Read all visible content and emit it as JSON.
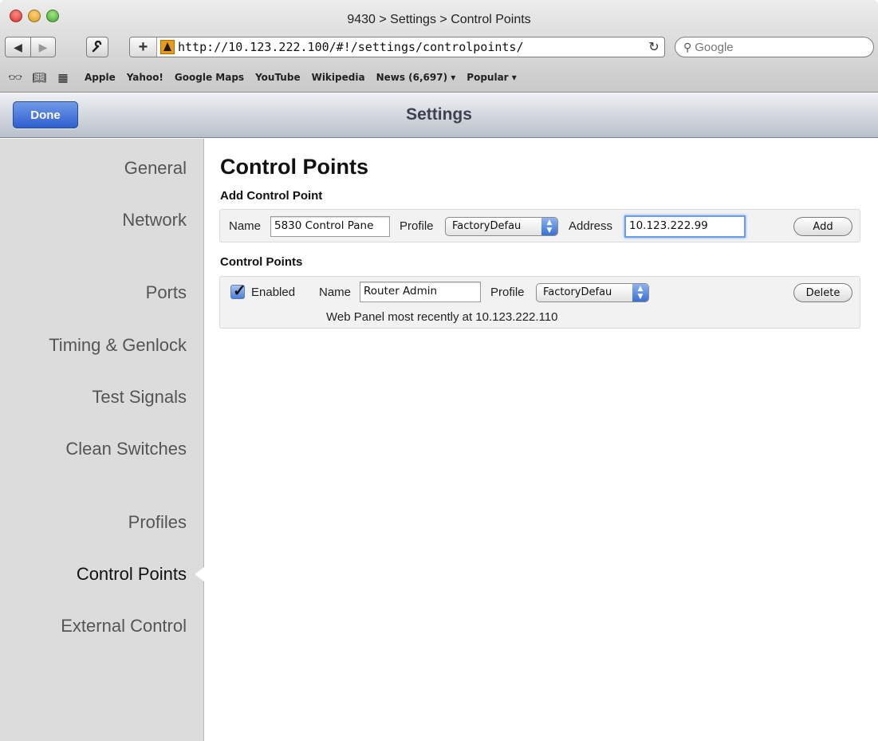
{
  "window": {
    "title": "9430 > Settings > Control Points"
  },
  "browser": {
    "url": "http://10.123.222.100/#!/settings/controlpoints/",
    "search_placeholder": "Google",
    "bookmarks": [
      "Apple",
      "Yahoo!",
      "Google Maps",
      "YouTube",
      "Wikipedia",
      "News (6,697) ▾",
      "Popular ▾"
    ]
  },
  "header": {
    "done_label": "Done",
    "title": "Settings"
  },
  "sidebar": {
    "items": [
      {
        "label": "General"
      },
      {
        "label": "Network"
      },
      {
        "label": "Ports"
      },
      {
        "label": "Timing & Genlock"
      },
      {
        "label": "Test Signals"
      },
      {
        "label": "Clean Switches"
      },
      {
        "label": "Profiles"
      },
      {
        "label": "Control Points"
      },
      {
        "label": "External Control"
      }
    ],
    "active": "Control Points"
  },
  "main": {
    "title": "Control Points",
    "add_section": {
      "title": "Add Control Point",
      "name_label": "Name",
      "name_value": "5830 Control Pane",
      "profile_label": "Profile",
      "profile_value": "FactoryDefau",
      "address_label": "Address",
      "address_value": "10.123.222.99",
      "add_label": "Add"
    },
    "list_section": {
      "title": "Control Points",
      "items": [
        {
          "enabled_label": "Enabled",
          "name_label": "Name",
          "name_value": "Router Admin",
          "profile_label": "Profile",
          "profile_value": "FactoryDefau",
          "delete_label": "Delete",
          "status": "Web Panel most recently at 10.123.222.110"
        }
      ]
    }
  }
}
